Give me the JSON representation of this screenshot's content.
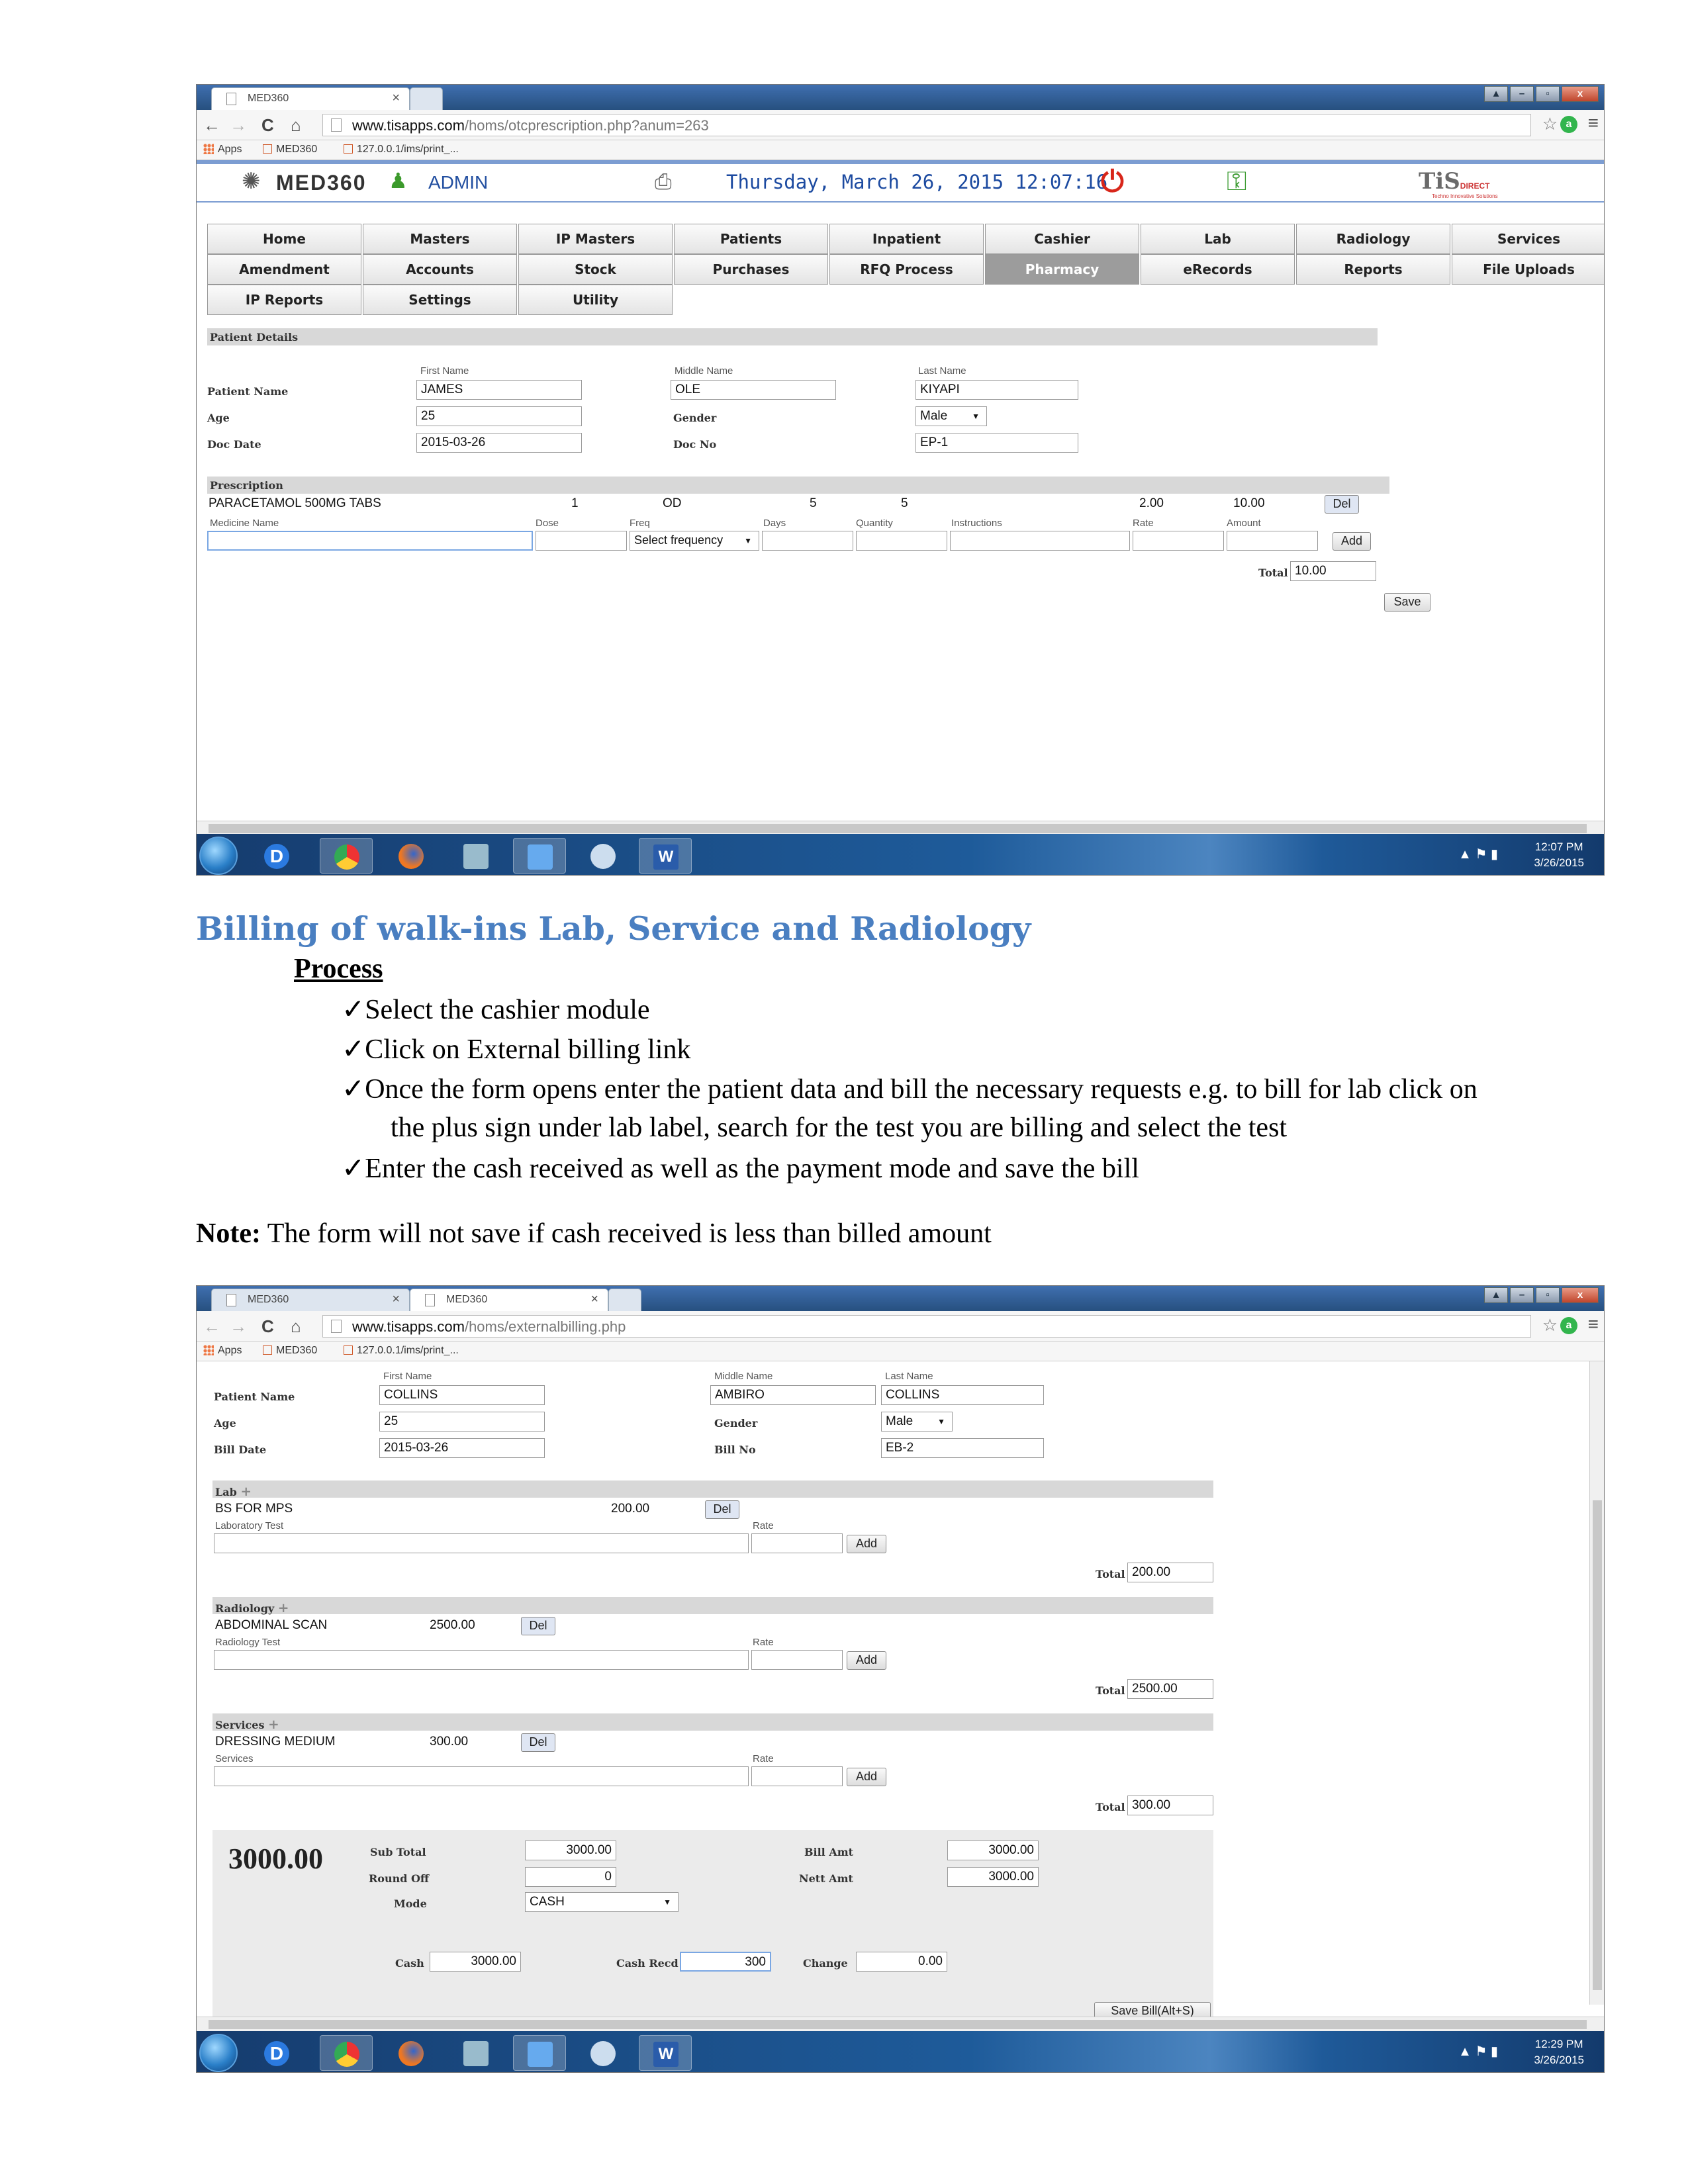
{
  "browser": {
    "app_tab": "MED360",
    "bookmarks": {
      "apps": "Apps",
      "med360": "MED360",
      "print": "127.0.0.1/ims/print_..."
    }
  },
  "screenshot1": {
    "url_domain": "www.tisapps.com",
    "url_path": "/homs/otcprescription.php?anum=263",
    "app": {
      "logo_text": "MED360",
      "user": "ADMIN",
      "datetime": "Thursday, March 26, 2015 12:07:16",
      "brand": "TiS",
      "brand_sub": "DIRECT",
      "brand_tagline": "Techno Innovative Solutions"
    },
    "menu_row1": [
      "Home",
      "Masters",
      "IP Masters",
      "Patients",
      "Inpatient",
      "Cashier",
      "Lab",
      "Radiology",
      "Services"
    ],
    "menu_row2": [
      "Amendment",
      "Accounts",
      "Stock",
      "Purchases",
      "RFQ Process",
      "Pharmacy",
      "eRecords",
      "Reports",
      "File Uploads"
    ],
    "menu_row3": [
      "IP Reports",
      "Settings",
      "Utility"
    ],
    "patient_section": "Patient Details",
    "labels": {
      "first_name": "First Name",
      "middle_name": "Middle Name",
      "last_name": "Last Name",
      "patient_name": "Patient Name",
      "age": "Age",
      "doc_date": "Doc Date",
      "gender": "Gender",
      "doc_no": "Doc No"
    },
    "values": {
      "first_name": "JAMES",
      "middle_name": "OLE",
      "last_name": "KIYAPI",
      "age": "25",
      "gender": "Male",
      "doc_date": "2015-03-26",
      "doc_no": "EP-1"
    },
    "prescription_section": "Prescription",
    "prescription_row": {
      "medicine": "PARACETAMOL  500MG TABS",
      "dose": "1",
      "freq": "OD",
      "days": "5",
      "quantity": "5",
      "rate": "2.00",
      "amount": "10.00",
      "del": "Del"
    },
    "columns": {
      "medicine": "Medicine Name",
      "dose": "Dose",
      "freq": "Freq",
      "days": "Days",
      "quantity": "Quantity",
      "instructions": "Instructions",
      "rate": "Rate",
      "amount": "Amount"
    },
    "freq_placeholder": "Select frequency",
    "add": "Add",
    "total_label": "Total",
    "total_value": "10.00",
    "save": "Save",
    "clock_time": "12:07 PM",
    "clock_date": "3/26/2015"
  },
  "document": {
    "heading": "Billing of walk-ins Lab, Service and Radiology",
    "process_title": "Process",
    "steps": [
      "Select the cashier module",
      "Click on External billing link",
      "Once the form opens enter the patient data and bill the necessary requests e.g. to bill for lab click on",
      "the plus sign under lab label, search for the test you are billing and select the test",
      "Enter the cash received as well as the payment mode and save the bill"
    ],
    "check": "✓",
    "note_label": "Note:",
    "note_text": "The form will not save if cash received is less than billed amount"
  },
  "screenshot2": {
    "url_domain": "www.tisapps.com",
    "url_path": "/homs/externalbilling.php",
    "tab1": "MED360",
    "tab2": "MED360",
    "labels": {
      "first_name": "First Name",
      "middle_name": "Middle Name",
      "last_name": "Last Name",
      "patient_name": "Patient Name",
      "age": "Age",
      "bill_date": "Bill Date",
      "gender": "Gender",
      "bill_no": "Bill No"
    },
    "values": {
      "first_name": "COLLINS",
      "middle_name": "AMBIRO",
      "last_name": "COLLINS",
      "age": "25",
      "gender": "Male",
      "bill_date": "2015-03-26",
      "bill_no": "EB-2"
    },
    "plus": "+",
    "lab": {
      "title": "Lab",
      "item": "BS FOR MPS",
      "price": "200.00",
      "test_label": "Laboratory Test",
      "rate_label": "Rate",
      "total": "200.00"
    },
    "radiology": {
      "title": "Radiology",
      "item": "ABDOMINAL SCAN",
      "price": "2500.00",
      "test_label": "Radiology Test",
      "rate_label": "Rate",
      "total": "2500.00"
    },
    "services": {
      "title": "Services",
      "item": "DRESSING MEDIUM",
      "price": "300.00",
      "test_label": "Services",
      "rate_label": "Rate",
      "total": "300.00"
    },
    "del": "Del",
    "add": "Add",
    "total_label": "Total",
    "summary": {
      "big_total": "3000.00",
      "sub_total_label": "Sub Total",
      "sub_total": "3000.00",
      "round_off_label": "Round Off",
      "round_off": "0",
      "mode_label": "Mode",
      "mode": "CASH",
      "bill_amt_label": "Bill Amt",
      "bill_amt": "3000.00",
      "nett_amt_label": "Nett Amt",
      "nett_amt": "3000.00",
      "cash_label": "Cash",
      "cash": "3000.00",
      "cash_recd_label": "Cash Recd",
      "cash_recd": "300",
      "change_label": "Change",
      "change": "0.00",
      "save_bill": "Save Bill(Alt+S)"
    },
    "clock_time": "12:29 PM",
    "clock_date": "3/26/2015"
  }
}
